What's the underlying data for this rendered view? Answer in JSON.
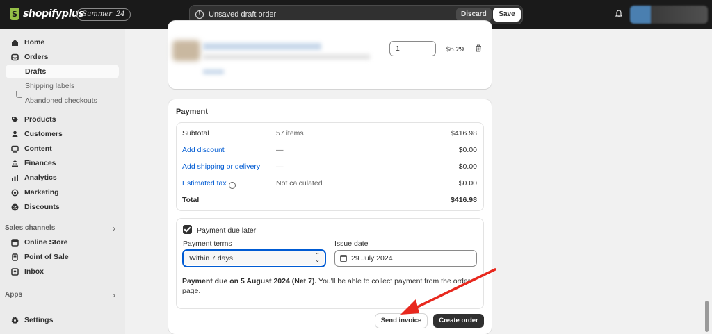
{
  "topbar": {
    "logo_text": "shopifyplus",
    "edition_badge": "Summer '24",
    "draft_message": "Unsaved draft order",
    "discard_label": "Discard",
    "save_label": "Save"
  },
  "sidebar": {
    "items": [
      {
        "label": "Home",
        "icon": "home-icon"
      },
      {
        "label": "Orders",
        "icon": "orders-icon"
      },
      {
        "label": "Drafts",
        "sub": true,
        "active": true
      },
      {
        "label": "Shipping labels",
        "sub": true
      },
      {
        "label": "Abandoned checkouts",
        "sub": true
      },
      {
        "label": "Products",
        "icon": "tag-icon"
      },
      {
        "label": "Customers",
        "icon": "person-icon"
      },
      {
        "label": "Content",
        "icon": "content-icon"
      },
      {
        "label": "Finances",
        "icon": "bank-icon"
      },
      {
        "label": "Analytics",
        "icon": "chart-icon"
      },
      {
        "label": "Marketing",
        "icon": "target-icon"
      },
      {
        "label": "Discounts",
        "icon": "discount-icon"
      },
      {
        "label": "Online Store",
        "icon": "store-icon"
      },
      {
        "label": "Point of Sale",
        "icon": "pos-icon"
      },
      {
        "label": "Inbox",
        "icon": "inbox-icon"
      },
      {
        "label": "Settings",
        "icon": "gear-icon"
      }
    ],
    "sales_channels_label": "Sales channels",
    "apps_label": "Apps"
  },
  "line_item": {
    "quantity": "1",
    "price": "$6.29"
  },
  "payment": {
    "title": "Payment",
    "rows": [
      {
        "label": "Subtotal",
        "detail": "57 items",
        "amount": "$416.98"
      },
      {
        "label": "Add discount",
        "detail": "—",
        "amount": "$0.00"
      },
      {
        "label": "Add shipping or delivery",
        "detail": "—",
        "amount": "$0.00"
      },
      {
        "label": "Estimated tax",
        "detail": "Not calculated",
        "amount": "$0.00"
      },
      {
        "label": "Total",
        "detail": "",
        "amount": "$416.98"
      }
    ],
    "payment_due_later_label": "Payment due later",
    "payment_due_later_checked": true,
    "terms_label": "Payment terms",
    "terms_value": "Within 7 days",
    "issue_date_label": "Issue date",
    "issue_date_value": "29 July 2024",
    "due_note_bold": "Payment due on 5 August 2024 (Net 7).",
    "due_note_rest": " You'll be able to collect payment from the order page.",
    "send_invoice_label": "Send invoice",
    "create_order_label": "Create order"
  },
  "colors": {
    "accent_link": "#005bd3",
    "topbar_bg": "#1a1a1a",
    "annotation_arrow": "#e8281e"
  }
}
